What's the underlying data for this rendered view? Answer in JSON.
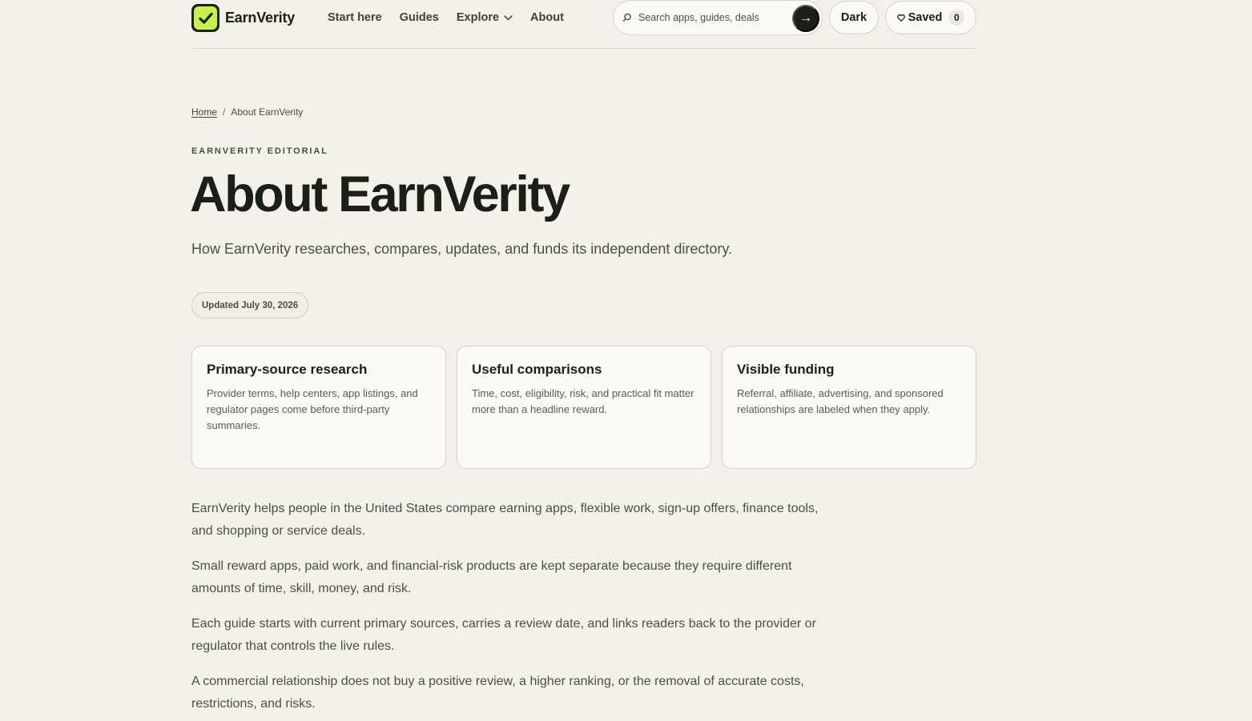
{
  "brand": {
    "name": "EarnVerity"
  },
  "nav": {
    "items": [
      {
        "label": "Start here"
      },
      {
        "label": "Guides"
      },
      {
        "label": "Explore"
      },
      {
        "label": "About"
      }
    ]
  },
  "search": {
    "placeholder": "Search apps, guides, deals",
    "submit_glyph": "→"
  },
  "header_actions": {
    "theme_label": "Dark",
    "saved_label": "Saved",
    "saved_count": "0"
  },
  "breadcrumb": {
    "home": "Home",
    "separator": "/",
    "current": "About EarnVerity"
  },
  "page": {
    "eyebrow": "EARNVERITY EDITORIAL",
    "title": "About EarnVerity",
    "subtitle": "How EarnVerity researches, compares, updates, and funds its independent directory.",
    "updated": "Updated July 30, 2026"
  },
  "cards": [
    {
      "title": "Primary-source research",
      "text": "Provider terms, help centers, app listings, and regulator pages come before third-party summaries."
    },
    {
      "title": "Useful comparisons",
      "text": "Time, cost, eligibility, risk, and practical fit matter more than a headline reward."
    },
    {
      "title": "Visible funding",
      "text": "Referral, affiliate, advertising, and sponsored relationships are labeled when they apply."
    }
  ],
  "body": [
    "EarnVerity helps people in the United States compare earning apps, flexible work, sign-up offers, finance tools, and shopping or service deals.",
    "Small reward apps, paid work, and financial-risk products are kept separate because they require different amounts of time, skill, money, and risk.",
    "Each guide starts with current primary sources, carries a review date, and links readers back to the provider or regulator that controls the live rules.",
    "A commercial relationship does not buy a positive review, a higher ranking, or the removal of accurate costs, restrictions, and risks."
  ],
  "colors": {
    "accent": "#c6f24e",
    "ink": "#1b1f18",
    "background": "#f3f1ea",
    "eyebrow": "#3a5a2c"
  }
}
